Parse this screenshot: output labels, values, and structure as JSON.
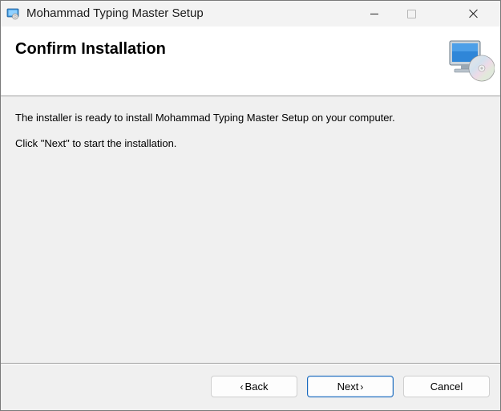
{
  "window": {
    "title": "Mohammad Typing Master Setup"
  },
  "banner": {
    "title": "Confirm Installation"
  },
  "content": {
    "line1": "The installer is ready to install Mohammad Typing Master Setup on your computer.",
    "line2": "Click \"Next\" to start the installation."
  },
  "buttons": {
    "back_label": "Back",
    "back_chevron": "‹",
    "next_label": "Next",
    "next_chevron": "›",
    "cancel_label": "Cancel"
  },
  "icons": {
    "app": "installer-app-icon",
    "banner": "computer-with-cd-icon",
    "minimize": "minimize-icon",
    "maximize": "maximize-icon",
    "close": "close-icon"
  },
  "colors": {
    "accent": "#1a6bbf",
    "banner_bg": "#ffffff",
    "window_bg": "#f0f0f0"
  }
}
